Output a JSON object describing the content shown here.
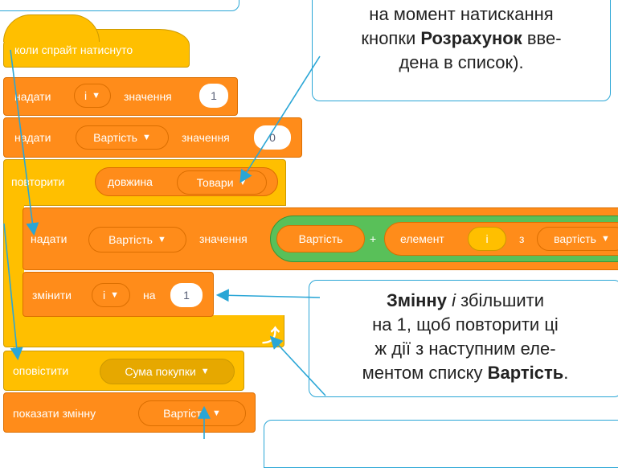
{
  "blocks": {
    "hat": "коли спрайт натиснуто",
    "set1": {
      "label": "надати",
      "var": "і",
      "value_label": "значення",
      "value": "1"
    },
    "set2": {
      "label": "надати",
      "var": "Вартість",
      "value_label": "значення",
      "value": "0"
    },
    "repeat": {
      "label": "повторити",
      "length_label": "довжина",
      "list": "Товари"
    },
    "inner_set": {
      "label": "надати",
      "var": "Вартість",
      "value_label": "значення",
      "var_reporter": "Вартість",
      "plus": "+",
      "item_label": "елемент",
      "index": "і",
      "of_label": "з",
      "list": "вартість"
    },
    "change": {
      "label": "змінити",
      "var": "і",
      "by_label": "на",
      "value": "1"
    },
    "broadcast": {
      "label": "оповістити",
      "message": "Сума покупки"
    },
    "show_var": {
      "label": "показати змінну",
      "var": "Вартість"
    }
  },
  "icons": {
    "dropdown": "triangle-down-icon",
    "loop": "loop-arrow-icon"
  },
  "colors": {
    "orange": "#ff8c1a",
    "dark_orange": "#db6e00",
    "yellow": "#ffbf00",
    "green": "#59c059",
    "callout_border": "#2aa6d6"
  },
  "callouts": {
    "top_right": {
      "line1": "на момент натискання",
      "line2_pre": "кнопки ",
      "line2_bold": "Розрахунок",
      "line2_post": " вве-",
      "line3": "дена в список)."
    },
    "middle_right": {
      "line1_bold": "Змінну",
      "line1_italic": "і",
      "line1_post": " збільшити",
      "line2": "на 1, щоб повторити ці",
      "line3": "ж дії з наступним еле-",
      "line4_pre": "ментом списку ",
      "line4_bold": "Вартість",
      "line4_post": "."
    }
  }
}
